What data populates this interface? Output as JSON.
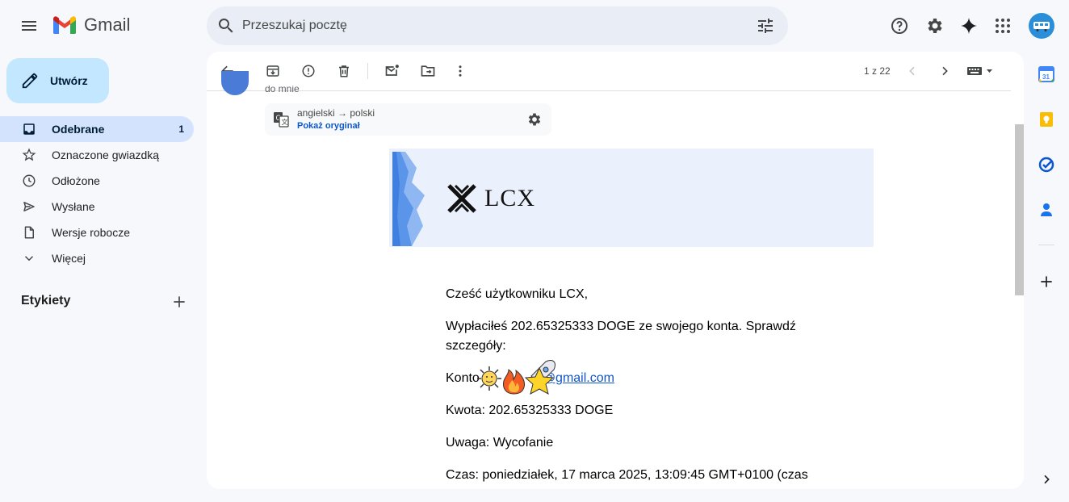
{
  "app": {
    "name": "Gmail"
  },
  "search": {
    "placeholder": "Przeszukaj pocztę"
  },
  "sidebar": {
    "compose_label": "Utwórz",
    "items": [
      {
        "label": "Odebrane",
        "count": "1",
        "icon": "inbox-icon"
      },
      {
        "label": "Oznaczone gwiazdką",
        "count": "",
        "icon": "star-icon"
      },
      {
        "label": "Odłożone",
        "count": "",
        "icon": "clock-icon"
      },
      {
        "label": "Wysłane",
        "count": "",
        "icon": "send-icon"
      },
      {
        "label": "Wersje robocze",
        "count": "",
        "icon": "draft-icon"
      },
      {
        "label": "Więcej",
        "count": "",
        "icon": "chevron-down-icon"
      }
    ],
    "labels_heading": "Etykiety"
  },
  "toolbar": {
    "pager": "1 z 22"
  },
  "message": {
    "to_me": "do mnie",
    "translation": {
      "languages": "angielski → polski",
      "show_original": "Pokaż oryginał"
    },
    "banner_brand": "LCX",
    "body": {
      "greeting": "Cześć użytkowniku LCX,",
      "line1": "Wypłaciłeś 202.65325333 DOGE ze swojego konta. Sprawdź szczegóły:",
      "account_label": "Konto",
      "account_email": "@gmail.com",
      "amount": "Kwota: 202.65325333 DOGE",
      "note": "Uwaga: Wycofanie",
      "time": "Czas: poniedziałek, 17 marca 2025, 13:09:45 GMT+0100 (czas"
    }
  },
  "colors": {
    "compose_bg": "#c2e7ff",
    "active_nav_bg": "#d3e3fd",
    "link": "#1155cc",
    "banner_bg": "#eaf1fd"
  }
}
